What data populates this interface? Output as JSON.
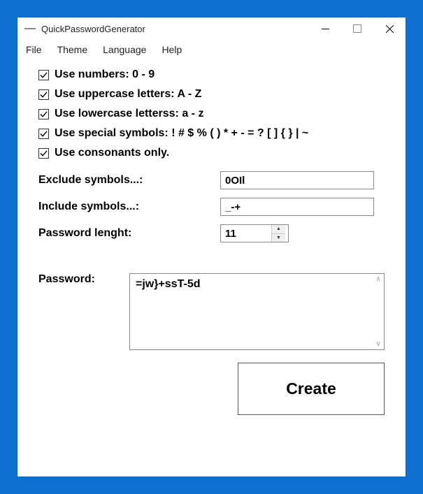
{
  "window": {
    "title": "QuickPasswordGenerator"
  },
  "menu": {
    "file": "File",
    "theme": "Theme",
    "language": "Language",
    "help": "Help"
  },
  "options": {
    "numbers": {
      "label": "Use numbers: 0 - 9",
      "checked": true
    },
    "uppercase": {
      "label": "Use uppercase letters: A - Z",
      "checked": true
    },
    "lowercase": {
      "label": "Use lowercase letterss: a - z",
      "checked": true
    },
    "special": {
      "label": "Use special symbols: ! # $ % ( ) * + - = ? [ ] { } | ~",
      "checked": true
    },
    "consonants": {
      "label": "Use consonants only.",
      "checked": true
    }
  },
  "fields": {
    "exclude_label": "Exclude symbols...:",
    "exclude_value": "0OIl",
    "include_label": "Include symbols...:",
    "include_value": "_-+",
    "length_label": "Password lenght:",
    "length_value": "11"
  },
  "output": {
    "label": "Password:",
    "value": "=jw}+ssT-5d"
  },
  "buttons": {
    "create": "Create"
  }
}
